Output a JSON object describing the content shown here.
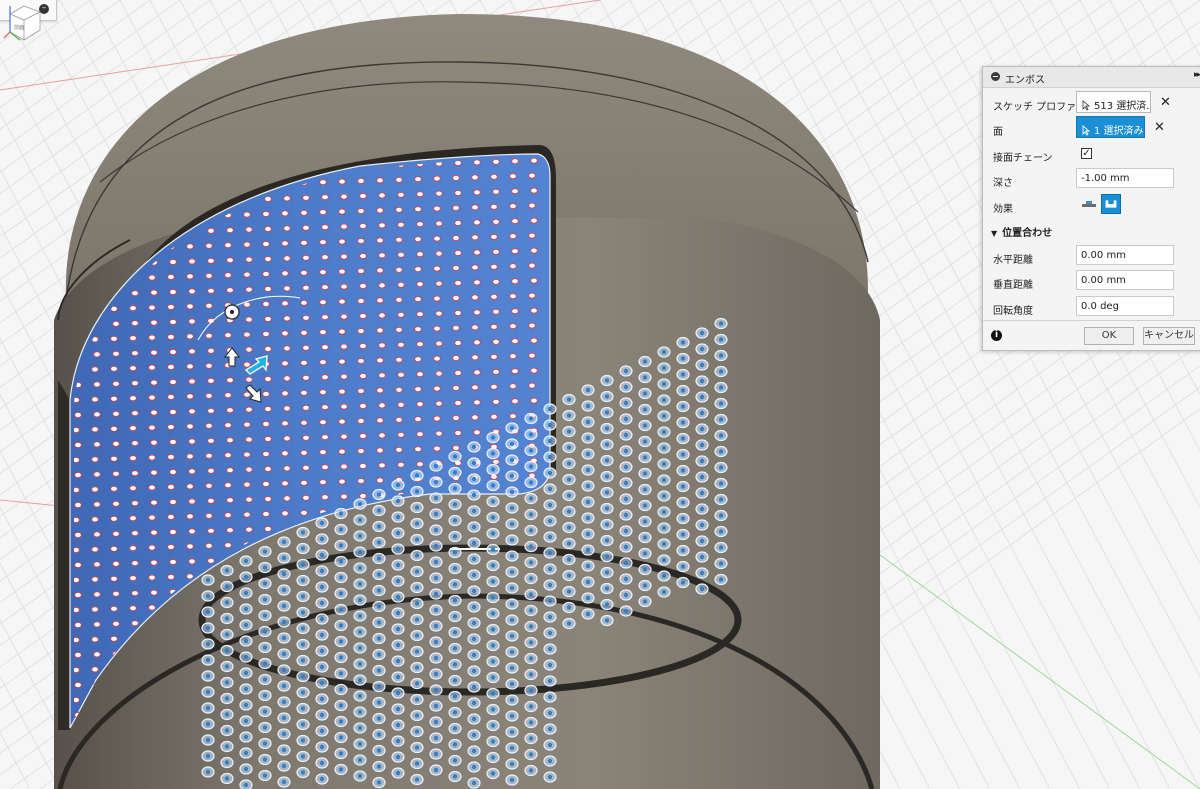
{
  "dialog": {
    "title": "エンボス",
    "sketch_profile": {
      "label": "スケッチ プロファイル",
      "value": "513 選択済..."
    },
    "face": {
      "label": "面",
      "value": "1 選択済み"
    },
    "tangent_chain": {
      "label": "接面チェーン",
      "checked": true,
      "mark": "✓"
    },
    "depth": {
      "label": "深さ",
      "value": "-1.00 mm"
    },
    "effect": {
      "label": "効果",
      "options": [
        "emboss-icon",
        "deboss-icon"
      ],
      "selected": "deboss-icon"
    },
    "alignment": {
      "section_label": "位置合わせ",
      "horizontal": {
        "label": "水平距離",
        "value": "0.00 mm"
      },
      "vertical": {
        "label": "垂直距離",
        "value": "0.00 mm"
      },
      "rotation": {
        "label": "回転角度",
        "value": "0.0 deg"
      }
    },
    "ok_label": "OK",
    "cancel_label": "キャンセル",
    "info_glyph": "i",
    "expand_glyph": "▸▸",
    "close_glyph": "✕"
  },
  "viewcube": {
    "face_label": "前面"
  },
  "colors": {
    "accent": "#1b8fd6",
    "body": "#7e786d",
    "body_dark": "#4e4a43",
    "selected_face": "#4a78c6",
    "grid": "#dcdcdc",
    "axis_red": "#e08080",
    "axis_green": "#7ec77e"
  }
}
